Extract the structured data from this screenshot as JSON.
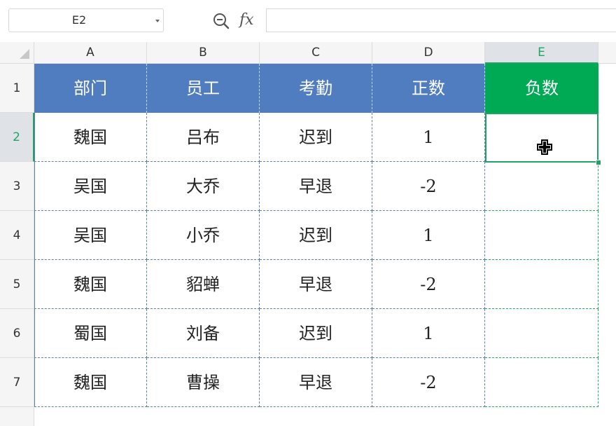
{
  "formula_bar": {
    "name_box": "E2",
    "fx_label": "fx",
    "formula": ""
  },
  "columns": [
    "A",
    "B",
    "C",
    "D",
    "E"
  ],
  "rows": [
    "1",
    "2",
    "3",
    "4",
    "5",
    "6",
    "7"
  ],
  "header": [
    "部门",
    "员工",
    "考勤",
    "正数",
    "负数"
  ],
  "data": [
    [
      "魏国",
      "吕布",
      "迟到",
      "1",
      ""
    ],
    [
      "吴国",
      "大乔",
      "早退",
      "-2",
      ""
    ],
    [
      "吴国",
      "小乔",
      "迟到",
      "1",
      ""
    ],
    [
      "魏国",
      "貂蝉",
      "早退",
      "-2",
      ""
    ],
    [
      "蜀国",
      "刘备",
      "迟到",
      "1",
      ""
    ],
    [
      "魏国",
      "曹操",
      "早退",
      "-2",
      ""
    ]
  ],
  "selection": {
    "cell": "E2",
    "column": "E",
    "row": "2"
  },
  "colors": {
    "header_blue": "#4f7dc0",
    "header_green": "#00aa55",
    "selection_green": "#21a366"
  },
  "icons": [
    "zoom-icon",
    "fx-icon",
    "dropdown-arrow-icon",
    "select-all-icon",
    "cell-cursor-icon"
  ]
}
